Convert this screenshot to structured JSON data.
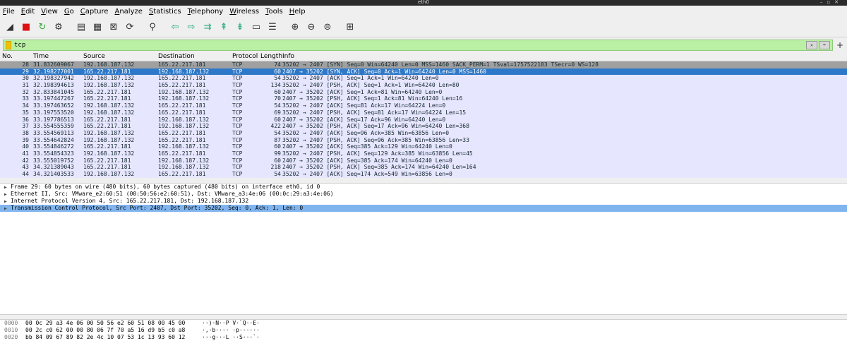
{
  "window": {
    "title": "eth0"
  },
  "menu": [
    "File",
    "Edit",
    "View",
    "Go",
    "Capture",
    "Analyze",
    "Statistics",
    "Telephony",
    "Wireless",
    "Tools",
    "Help"
  ],
  "toolbar": [
    {
      "icon": "shark-fin-icon",
      "glyph": "◢"
    },
    {
      "icon": "stop-capture-icon",
      "glyph": "■",
      "color": "#d11"
    },
    {
      "icon": "restart-capture-icon",
      "glyph": "↻",
      "color": "#3a3"
    },
    {
      "icon": "capture-options-icon",
      "glyph": "⚙"
    },
    {
      "icon": "open-file-icon",
      "glyph": "▤"
    },
    {
      "icon": "save-file-icon",
      "glyph": "▦"
    },
    {
      "icon": "close-file-icon",
      "glyph": "⊠"
    },
    {
      "icon": "reload-file-icon",
      "glyph": "⟳"
    },
    {
      "icon": "find-packet-icon",
      "glyph": "⚲"
    },
    {
      "icon": "go-back-icon",
      "glyph": "⇦",
      "color": "#2a7"
    },
    {
      "icon": "go-forward-icon",
      "glyph": "⇨",
      "color": "#2a7"
    },
    {
      "icon": "go-to-packet-icon",
      "glyph": "⇉",
      "color": "#2a7"
    },
    {
      "icon": "first-packet-icon",
      "glyph": "⇞",
      "color": "#2a7"
    },
    {
      "icon": "last-packet-icon",
      "glyph": "⇟",
      "color": "#2a7"
    },
    {
      "icon": "autoscroll-icon",
      "glyph": "▭"
    },
    {
      "icon": "colorize-icon",
      "glyph": "☰"
    },
    {
      "icon": "zoom-in-icon",
      "glyph": "⊕"
    },
    {
      "icon": "zoom-out-icon",
      "glyph": "⊖"
    },
    {
      "icon": "normal-size-icon",
      "glyph": "⊜"
    },
    {
      "icon": "resize-columns-icon",
      "glyph": "⊞"
    }
  ],
  "filter": {
    "value": "tcp"
  },
  "columns": {
    "no": "No.",
    "time": "Time",
    "source": "Source",
    "destination": "Destination",
    "protocol": "Protocol",
    "length": "Length",
    "info": "Info"
  },
  "packets": [
    {
      "no": "28",
      "time": "31.832609067",
      "src": "192.168.187.132",
      "dst": "165.22.217.181",
      "proto": "TCP",
      "len": "74",
      "info": "35202 → 2407 [SYN] Seq=0 Win=64240 Len=0 MSS=1460 SACK_PERM=1 TSval=1757522183 TSecr=0 WS=128",
      "style": "syn"
    },
    {
      "no": "29",
      "time": "32.198277001",
      "src": "165.22.217.181",
      "dst": "192.168.187.132",
      "proto": "TCP",
      "len": "60",
      "info": "2407 → 35202 [SYN, ACK] Seq=0 Ack=1 Win=64240 Len=0 MSS=1460",
      "style": "sel"
    },
    {
      "no": "30",
      "time": "32.198327942",
      "src": "192.168.187.132",
      "dst": "165.22.217.181",
      "proto": "TCP",
      "len": "54",
      "info": "35202 → 2407 [ACK] Seq=1 Ack=1 Win=64240 Len=0",
      "style": ""
    },
    {
      "no": "31",
      "time": "32.198394613",
      "src": "192.168.187.132",
      "dst": "165.22.217.181",
      "proto": "TCP",
      "len": "134",
      "info": "35202 → 2407 [PSH, ACK] Seq=1 Ack=1 Win=64240 Len=80",
      "style": ""
    },
    {
      "no": "32",
      "time": "32.833841045",
      "src": "165.22.217.181",
      "dst": "192.168.187.132",
      "proto": "TCP",
      "len": "60",
      "info": "2407 → 35202 [ACK] Seq=1 Ack=81 Win=64240 Len=0",
      "style": ""
    },
    {
      "no": "33",
      "time": "33.197447267",
      "src": "165.22.217.181",
      "dst": "192.168.187.132",
      "proto": "TCP",
      "len": "70",
      "info": "2407 → 35202 [PSH, ACK] Seq=1 Ack=81 Win=64240 Len=16",
      "style": ""
    },
    {
      "no": "34",
      "time": "33.197463652",
      "src": "192.168.187.132",
      "dst": "165.22.217.181",
      "proto": "TCP",
      "len": "54",
      "info": "35202 → 2407 [ACK] Seq=81 Ack=17 Win=64224 Len=0",
      "style": ""
    },
    {
      "no": "35",
      "time": "33.197553520",
      "src": "192.168.187.132",
      "dst": "165.22.217.181",
      "proto": "TCP",
      "len": "69",
      "info": "35202 → 2407 [PSH, ACK] Seq=81 Ack=17 Win=64224 Len=15",
      "style": ""
    },
    {
      "no": "36",
      "time": "33.197786513",
      "src": "165.22.217.181",
      "dst": "192.168.187.132",
      "proto": "TCP",
      "len": "60",
      "info": "2407 → 35202 [ACK] Seq=17 Ack=96 Win=64240 Len=0",
      "style": ""
    },
    {
      "no": "37",
      "time": "33.554555359",
      "src": "165.22.217.181",
      "dst": "192.168.187.132",
      "proto": "TCP",
      "len": "422",
      "info": "2407 → 35202 [PSH, ACK] Seq=17 Ack=96 Win=64240 Len=368",
      "style": ""
    },
    {
      "no": "38",
      "time": "33.554569113",
      "src": "192.168.187.132",
      "dst": "165.22.217.181",
      "proto": "TCP",
      "len": "54",
      "info": "35202 → 2407 [ACK] Seq=96 Ack=385 Win=63856 Len=0",
      "style": ""
    },
    {
      "no": "39",
      "time": "33.554642824",
      "src": "192.168.187.132",
      "dst": "165.22.217.181",
      "proto": "TCP",
      "len": "87",
      "info": "35202 → 2407 [PSH, ACK] Seq=96 Ack=385 Win=63856 Len=33",
      "style": ""
    },
    {
      "no": "40",
      "time": "33.554846272",
      "src": "165.22.217.181",
      "dst": "192.168.187.132",
      "proto": "TCP",
      "len": "60",
      "info": "2407 → 35202 [ACK] Seq=385 Ack=129 Win=64240 Len=0",
      "style": ""
    },
    {
      "no": "41",
      "time": "33.554854323",
      "src": "192.168.187.132",
      "dst": "165.22.217.181",
      "proto": "TCP",
      "len": "99",
      "info": "35202 → 2407 [PSH, ACK] Seq=129 Ack=385 Win=63856 Len=45",
      "style": ""
    },
    {
      "no": "42",
      "time": "33.555019752",
      "src": "165.22.217.181",
      "dst": "192.168.187.132",
      "proto": "TCP",
      "len": "60",
      "info": "2407 → 35202 [ACK] Seq=385 Ack=174 Win=64240 Len=0",
      "style": ""
    },
    {
      "no": "43",
      "time": "34.321389043",
      "src": "165.22.217.181",
      "dst": "192.168.187.132",
      "proto": "TCP",
      "len": "218",
      "info": "2407 → 35202 [PSH, ACK] Seq=385 Ack=174 Win=64240 Len=164",
      "style": ""
    },
    {
      "no": "44",
      "time": "34.321403533",
      "src": "192.168.187.132",
      "dst": "165.22.217.181",
      "proto": "TCP",
      "len": "54",
      "info": "35202 → 2407 [ACK] Seq=174 Ack=549 Win=63856 Len=0",
      "style": ""
    }
  ],
  "details": [
    {
      "text": "Frame 29: 60 bytes on wire (480 bits), 60 bytes captured (480 bits) on interface eth0, id 0",
      "selected": false
    },
    {
      "text": "Ethernet II, Src: VMware_e2:60:51 (00:50:56:e2:60:51), Dst: VMware_a3:4e:06 (00:0c:29:a3:4e:06)",
      "selected": false
    },
    {
      "text": "Internet Protocol Version 4, Src: 165.22.217.181, Dst: 192.168.187.132",
      "selected": false
    },
    {
      "text": "Transmission Control Protocol, Src Port: 2407, Dst Port: 35202, Seq: 0, Ack: 1, Len: 0",
      "selected": true
    }
  ],
  "hex": [
    {
      "off": "0000",
      "bytes": "00 0c 29 a3 4e 06 00 50  56 e2 60 51 08 00 45 00",
      "ascii": "··)·N··P V·`Q··E·"
    },
    {
      "off": "0010",
      "bytes": "00 2c c0 62 00 00 80 06  7f 70 a5 16 d9 b5 c0 a8",
      "ascii": "·,·b···· ·p······"
    },
    {
      "off": "0020",
      "bytes": "bb 84 09 67 89 82 2e 4c  10 07 53 1c 13 93 60 12",
      "ascii": "···g···L ··S···`·"
    }
  ]
}
